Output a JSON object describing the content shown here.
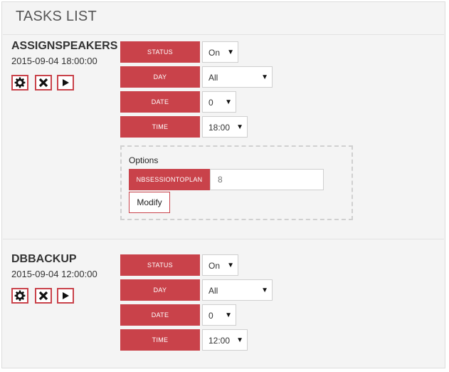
{
  "page_title": "TASKS LIST",
  "tasks": [
    {
      "name": "ASSIGNSPEAKERS",
      "datetime": "2015-09-04 18:00:00",
      "fields": [
        {
          "label": "STATUS",
          "value": "On"
        },
        {
          "label": "DAY",
          "value": "All"
        },
        {
          "label": "DATE",
          "value": "0"
        },
        {
          "label": "TIME",
          "value": "18:00"
        }
      ],
      "options": {
        "title": "Options",
        "param_label": "NBSESSIONTOPLAN",
        "param_value": "8",
        "modify_label": "Modify"
      }
    },
    {
      "name": "DBBACKUP",
      "datetime": "2015-09-04 12:00:00",
      "fields": [
        {
          "label": "STATUS",
          "value": "On"
        },
        {
          "label": "DAY",
          "value": "All"
        },
        {
          "label": "DATE",
          "value": "0"
        },
        {
          "label": "TIME",
          "value": "12:00"
        }
      ]
    }
  ],
  "icons": {
    "settings": "gear-icon",
    "delete": "close-icon",
    "run": "play-icon",
    "dropdown": "caret-down-icon"
  },
  "colors": {
    "accent": "#c9424a",
    "panel_bg": "#f4f4f4",
    "text": "#333333"
  }
}
